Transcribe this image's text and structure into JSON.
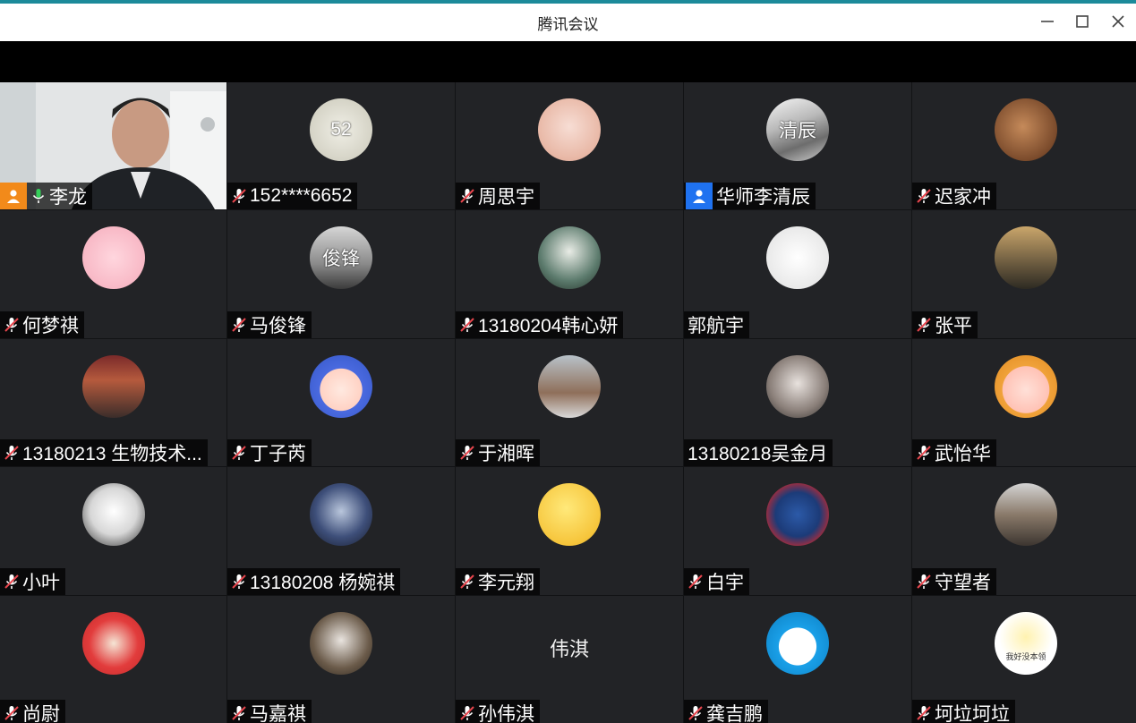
{
  "window": {
    "title": "腾讯会议"
  },
  "participants": [
    {
      "name": "李龙",
      "role": "host",
      "mic": "on",
      "avatar": "video"
    },
    {
      "name": "152****6652",
      "mic": "muted",
      "avatar": "gamepad",
      "avatar_text": "52"
    },
    {
      "name": "周思宇",
      "mic": "muted",
      "avatar": "girl-face"
    },
    {
      "name": "华师李清辰",
      "role": "cohost",
      "avatar": "snow-photo",
      "avatar_text": "清辰"
    },
    {
      "name": "迟家冲",
      "mic": "muted",
      "avatar": "child-photo"
    },
    {
      "name": "何梦祺",
      "mic": "muted",
      "avatar": "pig"
    },
    {
      "name": "马俊锋",
      "mic": "muted",
      "avatar": "street-photo",
      "avatar_text": "俊锋"
    },
    {
      "name": "13180204韩心妍",
      "mic": "muted",
      "avatar": "anime-boy"
    },
    {
      "name": "郭航宇",
      "avatar": "panda-meme"
    },
    {
      "name": "张平",
      "mic": "muted",
      "avatar": "bike-photo"
    },
    {
      "name": "13180213 生物技术...",
      "mic": "muted",
      "avatar": "night-photo"
    },
    {
      "name": "丁子芮",
      "mic": "muted",
      "avatar": "maruko"
    },
    {
      "name": "于湘晖",
      "mic": "muted",
      "avatar": "tree-photo"
    },
    {
      "name": "13180218吴金月",
      "avatar": "girl-photo"
    },
    {
      "name": "武怡华",
      "mic": "muted",
      "avatar": "cartoon-girl"
    },
    {
      "name": "小叶",
      "mic": "muted",
      "avatar": "anime-sketch"
    },
    {
      "name": "13180208 杨婉祺",
      "mic": "muted",
      "avatar": "anime-hero"
    },
    {
      "name": "李元翔",
      "mic": "muted",
      "avatar": "smiley"
    },
    {
      "name": "白宇",
      "mic": "muted",
      "avatar": "captain"
    },
    {
      "name": "守望者",
      "mic": "muted",
      "avatar": "forest-photo"
    },
    {
      "name": "尚尉",
      "mic": "muted",
      "avatar": "red-cartoon"
    },
    {
      "name": "马嘉祺",
      "mic": "muted",
      "avatar": "mask-photo"
    },
    {
      "name": "孙伟淇",
      "mic": "muted",
      "avatar": "none",
      "avatar_text": "伟淇"
    },
    {
      "name": "龚吉鹏",
      "mic": "muted",
      "avatar": "doraemon"
    },
    {
      "name": "坷垃坷垃",
      "mic": "muted",
      "avatar": "sticker",
      "avatar_text": "我好没本领"
    }
  ]
}
